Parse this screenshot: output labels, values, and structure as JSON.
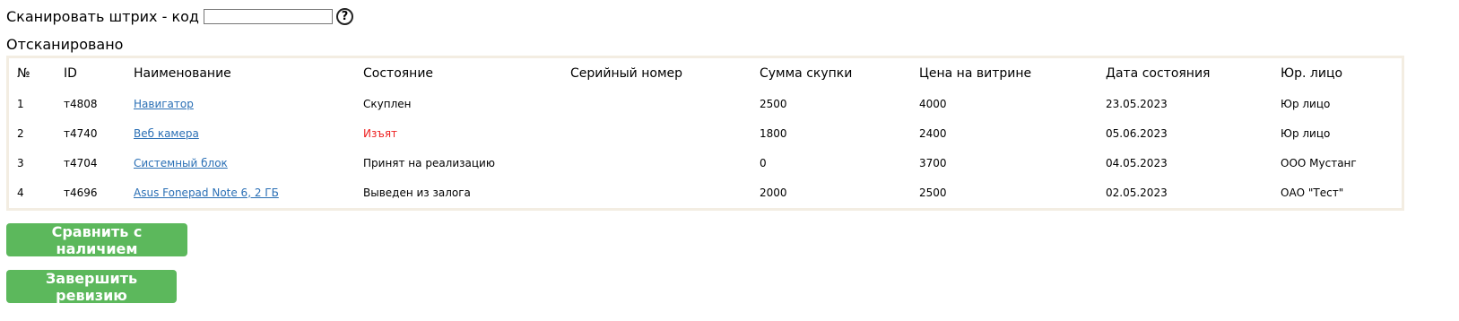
{
  "scan": {
    "label": "Сканировать штрих - код",
    "input_value": "",
    "help_icon": "question-circle-icon",
    "help_glyph": "?"
  },
  "scanned": {
    "title": "Отсканировано",
    "columns": [
      "№",
      "ID",
      "Наименование",
      "Состояние",
      "Серийный номер",
      "Сумма скупки",
      "Цена на витрине",
      "Дата состояния",
      "Юр. лицо"
    ],
    "rows": [
      {
        "num": "1",
        "id": "т4808",
        "name": "Навигатор",
        "status": "Скуплен",
        "status_color": "#000000",
        "serial": "",
        "purchase": "2500",
        "price": "4000",
        "date": "23.05.2023",
        "entity": "Юр лицо"
      },
      {
        "num": "2",
        "id": "т4740",
        "name": "Веб камера",
        "status": "Изъят",
        "status_color": "#ee2222",
        "serial": "",
        "purchase": "1800",
        "price": "2400",
        "date": "05.06.2023",
        "entity": "Юр лицо"
      },
      {
        "num": "3",
        "id": "т4704",
        "name": "Системный блок",
        "status": "Принят на реализацию",
        "status_color": "#000000",
        "serial": "",
        "purchase": "0",
        "price": "3700",
        "date": "04.05.2023",
        "entity": "ООО Мустанг"
      },
      {
        "num": "4",
        "id": "т4696",
        "name": "Asus Fonepad Note 6, 2 ГБ",
        "status": "Выведен из залога",
        "status_color": "#000000",
        "serial": "",
        "purchase": "2000",
        "price": "2500",
        "date": "02.05.2023",
        "entity": "ОАО \"Тест\""
      }
    ]
  },
  "buttons": {
    "compare_label": "Сравнить с наличием",
    "finish_label": "Завершить ревизию"
  },
  "colors": {
    "button_bg": "#5cb85c",
    "link": "#2a6fb5",
    "status_seized": "#ee2222",
    "table_border": "#f3ede2"
  }
}
